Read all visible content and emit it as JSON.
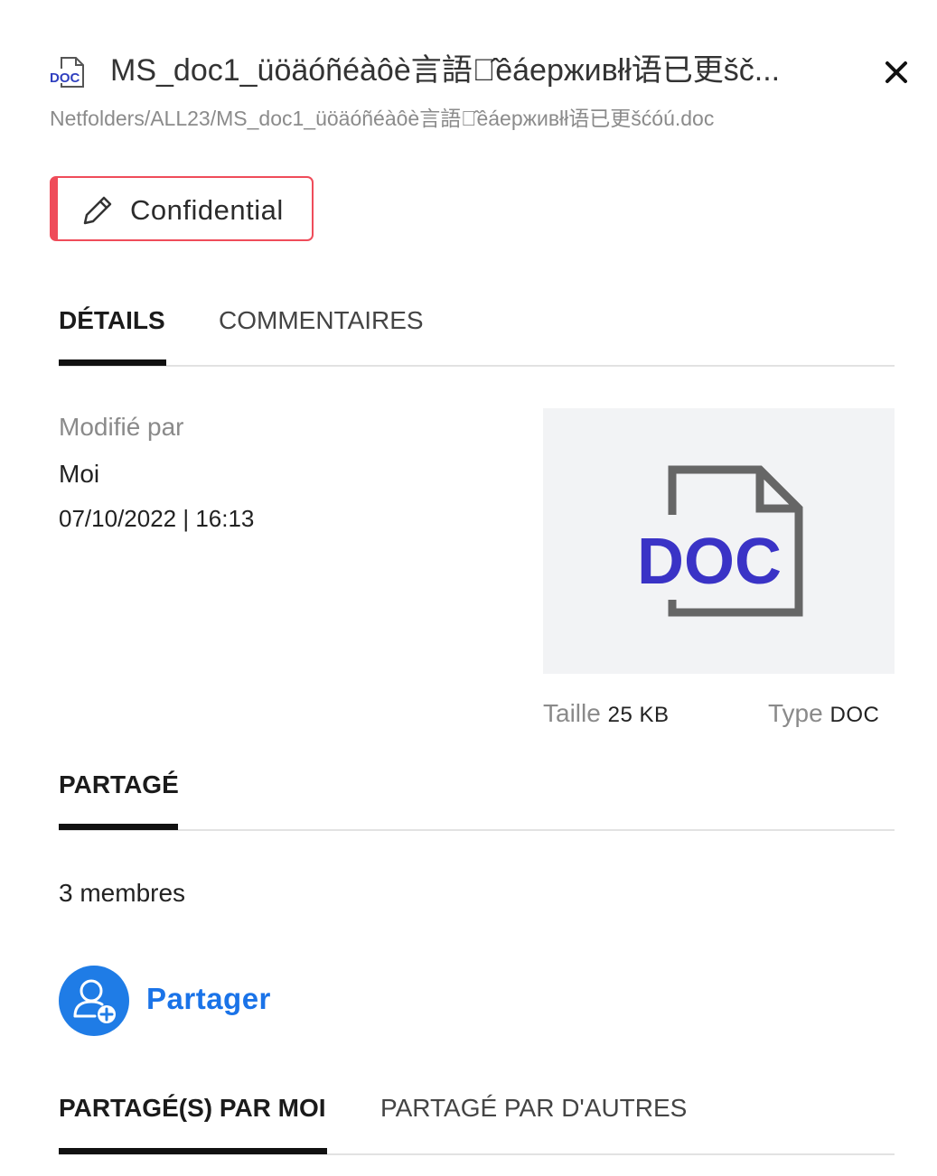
{
  "header": {
    "file_icon_name": "doc-file-icon",
    "file_icon_text": "DOC",
    "title": "MS_doc1_üöäóñéàôè言語が̂êáерживłł语已更šč...",
    "path": "Netfolders/ALL23/MS_doc1_üöäóñéàôè言語が̂êáерживłł语已更šćóú.doc",
    "close_icon_name": "close-icon"
  },
  "classification": {
    "label": "Confidential",
    "icon_name": "pencil-icon",
    "color": "#ef4c5a"
  },
  "tabs": [
    {
      "label": "DÉTAILS",
      "active": true
    },
    {
      "label": "COMMENTAIRES",
      "active": false
    }
  ],
  "details": {
    "modified_by_label": "Modifié par",
    "modified_by": "Moi",
    "modified_date": "07/10/2022 | 16:13",
    "preview_text": "DOC",
    "size_label": "Taille",
    "size_value": "25 KB",
    "type_label": "Type",
    "type_value": "DOC"
  },
  "sharing": {
    "section_title": "PARTAGÉ",
    "member_count": "3 membres",
    "share_button_label": "Partager",
    "share_icon_name": "add-user-icon",
    "accent_color": "#1f7ce6"
  },
  "share_tabs": [
    {
      "label": "PARTAGÉ(S) PAR MOI",
      "active": true
    },
    {
      "label": "PARTAGÉ PAR D'AUTRES",
      "active": false
    }
  ]
}
